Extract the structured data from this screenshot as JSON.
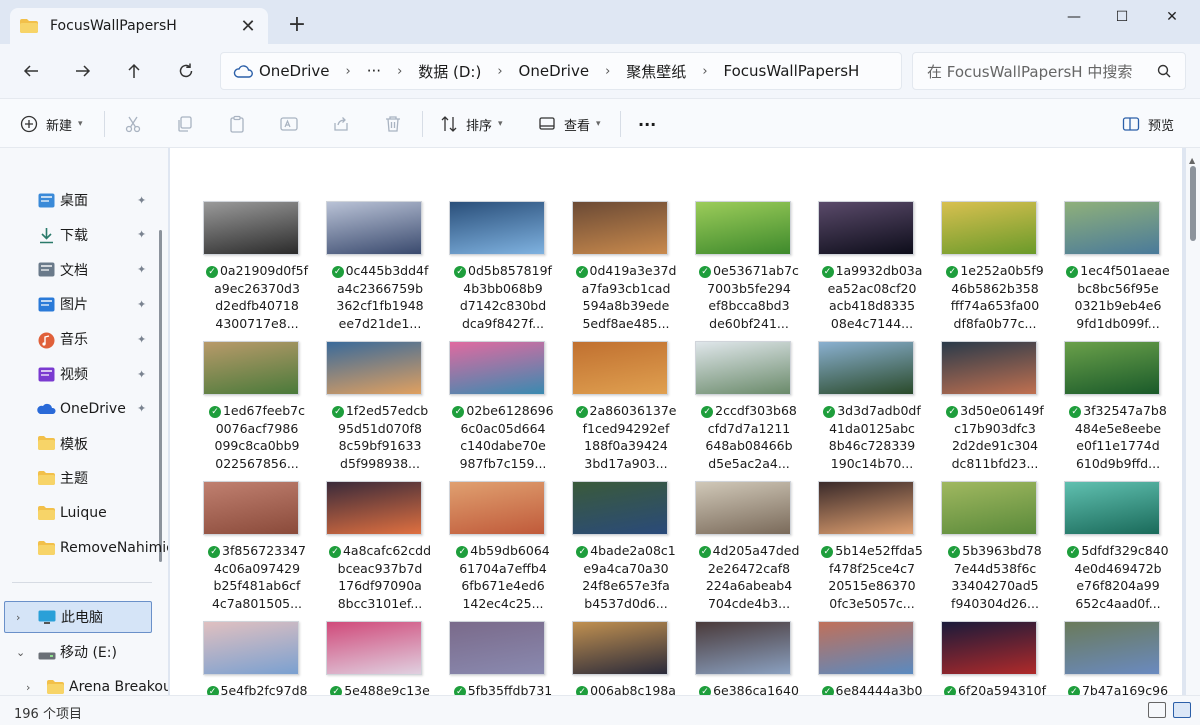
{
  "window": {
    "tab_title": "FocusWallPapersH",
    "tab_close": "✕",
    "new_tab": "+",
    "minimize": "—",
    "maximize": "☐",
    "close": "✕"
  },
  "breadcrumb": [
    "OneDrive",
    "···",
    "数据 (D:)",
    "OneDrive",
    "聚焦壁纸",
    "FocusWallPapersH"
  ],
  "breadcrumb_sep": "›",
  "search": {
    "placeholder": "在 FocusWallPapersH 中搜索"
  },
  "commands": {
    "new": "新建",
    "sort": "排序",
    "view": "查看",
    "more": "···",
    "preview": "预览"
  },
  "sidebar": {
    "quick_access": [
      {
        "label": "桌面",
        "icon": "desktop-icon",
        "pinned": true
      },
      {
        "label": "下载",
        "icon": "download-icon",
        "pinned": true
      },
      {
        "label": "文档",
        "icon": "documents-icon",
        "pinned": true
      },
      {
        "label": "图片",
        "icon": "pictures-icon",
        "pinned": true
      },
      {
        "label": "音乐",
        "icon": "music-icon",
        "pinned": true
      },
      {
        "label": "视频",
        "icon": "videos-icon",
        "pinned": true
      },
      {
        "label": "OneDrive",
        "icon": "onedrive-icon",
        "pinned": true
      },
      {
        "label": "模板",
        "icon": "folder-icon",
        "pinned": false
      },
      {
        "label": "主题",
        "icon": "folder-icon",
        "pinned": false
      },
      {
        "label": "Luique",
        "icon": "folder-icon",
        "pinned": false
      },
      {
        "label": "RemoveNahimic",
        "icon": "folder-icon",
        "pinned": false
      }
    ],
    "pin_glyph": "📌",
    "this_pc": "此电脑",
    "drive": "移动 (E:)",
    "drive_child": "Arena Breakout"
  },
  "files": [
    [
      "0a21909d0f5f",
      "a9ec26370d3",
      "d2edfb40718",
      "4300717e8..."
    ],
    [
      "0c445b3dd4f",
      "a4c2366759b",
      "362cf1fb1948",
      "ee7d21de1..."
    ],
    [
      "0d5b857819f",
      "4b3bb068b9",
      "d7142c830bd",
      "dca9f8427f..."
    ],
    [
      "0d419a3e37d",
      "a7fa93cb1cad",
      "594a8b39ede",
      "5edf8ae485..."
    ],
    [
      "0e53671ab7c",
      "7003b5fe294",
      "ef8bcca8bd3",
      "de60bf241..."
    ],
    [
      "1a9932db03a",
      "ea52ac08cf20",
      "acb418d8335",
      "08e4c7144..."
    ],
    [
      "1e252a0b5f9",
      "46b5862b358",
      "fff74a653fa00",
      "df8fa0b77c..."
    ],
    [
      "1ec4f501aeae",
      "bc8bc56f95e",
      "0321b9eb4e6",
      "9fd1db099f..."
    ],
    [
      "1ed67feeb7c",
      "0076acf7986",
      "099c8ca0bb9",
      "022567856..."
    ],
    [
      "1f2ed57edcb",
      "95d51d070f8",
      "8c59bf91633",
      "d5f998938..."
    ],
    [
      "02be6128696",
      "6c0ac05d664",
      "c140dabe70e",
      "987fb7c159..."
    ],
    [
      "2a86036137e",
      "f1ced94292ef",
      "188f0a39424",
      "3bd17a903..."
    ],
    [
      "2ccdf303b68",
      "cfd7d7a1211",
      "648ab08466b",
      "d5e5ac2a4..."
    ],
    [
      "3d3d7adb0df",
      "41da0125abc",
      "8b46c728339",
      "190c14b70..."
    ],
    [
      "3d50e06149f",
      "c17b903dfc3",
      "2d2de91c304",
      "dc811bfd23..."
    ],
    [
      "3f32547a7b8",
      "484e5e8eebe",
      "e0f11e1774d",
      "610d9b9ffd..."
    ],
    [
      "3f856723347",
      "4c06a097429",
      "b25f481ab6cf",
      "4c7a801505..."
    ],
    [
      "4a8cafc62cdd",
      "bceac937b7d",
      "176df97090a",
      "8bcc3101ef..."
    ],
    [
      "4b59db6064",
      "61704a7effb4",
      "6fb671e4ed6",
      "142ec4c25..."
    ],
    [
      "4bade2a08c1",
      "e9a4ca70a30",
      "24f8e657e3fa",
      "b4537d0d6..."
    ],
    [
      "4d205a47ded",
      "2e26472caf8",
      "224a6abeab4",
      "704cde4b3..."
    ],
    [
      "5b14e52ffda5",
      "f478f25ce4c7",
      "20515e86370",
      "0fc3e5057c..."
    ],
    [
      "5b3963bd78",
      "7e44d538f6c",
      "33404270ad5",
      "f940304d26..."
    ],
    [
      "5dfdf329c840",
      "4e0d469472b",
      "e76f8204a99",
      "652c4aad0f..."
    ],
    [
      "5e4fb2fc97d8"
    ],
    [
      "5e488e9c13e"
    ],
    [
      "5fb35ffdb731"
    ],
    [
      "006ab8c198a"
    ],
    [
      "6e386ca1640"
    ],
    [
      "6e84444a3b0"
    ],
    [
      "6f20a594310f"
    ],
    [
      "7b47a169c96"
    ]
  ],
  "thumbnail_colors": [
    [
      "#2b2b2b",
      "#9a9a9a"
    ],
    [
      "#3a4a6e",
      "#b9c2d6"
    ],
    [
      "#7fb2e0",
      "#2a4f7a"
    ],
    [
      "#c98a4d",
      "#6b4a35"
    ],
    [
      "#3e8a2c",
      "#9ccc5a"
    ],
    [
      "#0d0d1a",
      "#5a4a6a"
    ],
    [
      "#6a9a2a",
      "#d8c050"
    ],
    [
      "#4a7a9a",
      "#8fb07a"
    ],
    [
      "#4a7a3a",
      "#b89a6a"
    ],
    [
      "#e0a060",
      "#3a6a9a"
    ],
    [
      "#3a8ab0",
      "#e06aa0"
    ],
    [
      "#e0a050",
      "#c07030"
    ],
    [
      "#6a8a6a",
      "#dfe6ea"
    ],
    [
      "#2a4a2a",
      "#8ab0d0"
    ],
    [
      "#c07050",
      "#2a3a4a"
    ],
    [
      "#1a5a2a",
      "#6aa04a"
    ],
    [
      "#8a4a3a",
      "#c08070"
    ],
    [
      "#e07040",
      "#3a2a3a"
    ],
    [
      "#c05a3a",
      "#e0a070"
    ],
    [
      "#2a4a7a",
      "#3a5a3a"
    ],
    [
      "#7a6a5a",
      "#d0c8b8"
    ],
    [
      "#e0a070",
      "#3a2a2a"
    ],
    [
      "#5a8a3a",
      "#a0b860"
    ],
    [
      "#1a6a5a",
      "#60c0b0"
    ],
    [
      "#7aa0d0",
      "#e0c0c0"
    ],
    [
      "#e0d0e0",
      "#d04a7a"
    ],
    [
      "#8a8ab0",
      "#7a6a8a"
    ],
    [
      "#2a2a3a",
      "#c09050"
    ],
    [
      "#8aa0c0",
      "#4a3a3a"
    ],
    [
      "#5a8ac0",
      "#c0705a"
    ],
    [
      "#b02a2a",
      "#1a1a3a"
    ],
    [
      "#6a8ac0",
      "#6a7a5a"
    ]
  ],
  "status": {
    "count": "196 个项目"
  }
}
